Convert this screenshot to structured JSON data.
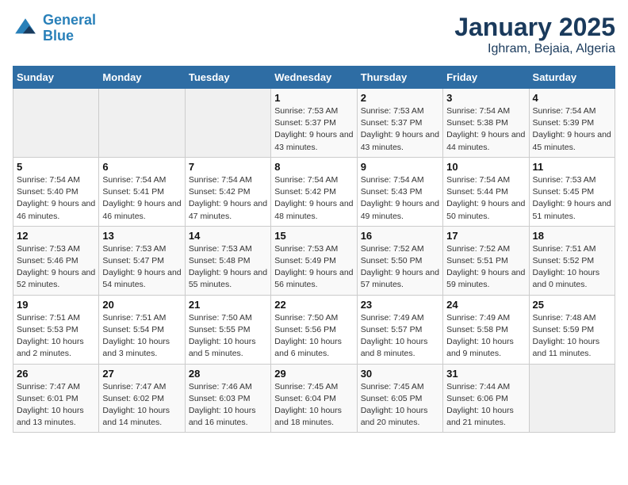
{
  "logo": {
    "line1": "General",
    "line2": "Blue"
  },
  "title": "January 2025",
  "subtitle": "Ighram, Bejaia, Algeria",
  "weekdays": [
    "Sunday",
    "Monday",
    "Tuesday",
    "Wednesday",
    "Thursday",
    "Friday",
    "Saturday"
  ],
  "weeks": [
    [
      {
        "num": "",
        "info": ""
      },
      {
        "num": "",
        "info": ""
      },
      {
        "num": "",
        "info": ""
      },
      {
        "num": "1",
        "info": "Sunrise: 7:53 AM\nSunset: 5:37 PM\nDaylight: 9 hours\nand 43 minutes."
      },
      {
        "num": "2",
        "info": "Sunrise: 7:53 AM\nSunset: 5:37 PM\nDaylight: 9 hours\nand 43 minutes."
      },
      {
        "num": "3",
        "info": "Sunrise: 7:54 AM\nSunset: 5:38 PM\nDaylight: 9 hours\nand 44 minutes."
      },
      {
        "num": "4",
        "info": "Sunrise: 7:54 AM\nSunset: 5:39 PM\nDaylight: 9 hours\nand 45 minutes."
      }
    ],
    [
      {
        "num": "5",
        "info": "Sunrise: 7:54 AM\nSunset: 5:40 PM\nDaylight: 9 hours\nand 46 minutes."
      },
      {
        "num": "6",
        "info": "Sunrise: 7:54 AM\nSunset: 5:41 PM\nDaylight: 9 hours\nand 46 minutes."
      },
      {
        "num": "7",
        "info": "Sunrise: 7:54 AM\nSunset: 5:42 PM\nDaylight: 9 hours\nand 47 minutes."
      },
      {
        "num": "8",
        "info": "Sunrise: 7:54 AM\nSunset: 5:42 PM\nDaylight: 9 hours\nand 48 minutes."
      },
      {
        "num": "9",
        "info": "Sunrise: 7:54 AM\nSunset: 5:43 PM\nDaylight: 9 hours\nand 49 minutes."
      },
      {
        "num": "10",
        "info": "Sunrise: 7:54 AM\nSunset: 5:44 PM\nDaylight: 9 hours\nand 50 minutes."
      },
      {
        "num": "11",
        "info": "Sunrise: 7:53 AM\nSunset: 5:45 PM\nDaylight: 9 hours\nand 51 minutes."
      }
    ],
    [
      {
        "num": "12",
        "info": "Sunrise: 7:53 AM\nSunset: 5:46 PM\nDaylight: 9 hours\nand 52 minutes."
      },
      {
        "num": "13",
        "info": "Sunrise: 7:53 AM\nSunset: 5:47 PM\nDaylight: 9 hours\nand 54 minutes."
      },
      {
        "num": "14",
        "info": "Sunrise: 7:53 AM\nSunset: 5:48 PM\nDaylight: 9 hours\nand 55 minutes."
      },
      {
        "num": "15",
        "info": "Sunrise: 7:53 AM\nSunset: 5:49 PM\nDaylight: 9 hours\nand 56 minutes."
      },
      {
        "num": "16",
        "info": "Sunrise: 7:52 AM\nSunset: 5:50 PM\nDaylight: 9 hours\nand 57 minutes."
      },
      {
        "num": "17",
        "info": "Sunrise: 7:52 AM\nSunset: 5:51 PM\nDaylight: 9 hours\nand 59 minutes."
      },
      {
        "num": "18",
        "info": "Sunrise: 7:51 AM\nSunset: 5:52 PM\nDaylight: 10 hours\nand 0 minutes."
      }
    ],
    [
      {
        "num": "19",
        "info": "Sunrise: 7:51 AM\nSunset: 5:53 PM\nDaylight: 10 hours\nand 2 minutes."
      },
      {
        "num": "20",
        "info": "Sunrise: 7:51 AM\nSunset: 5:54 PM\nDaylight: 10 hours\nand 3 minutes."
      },
      {
        "num": "21",
        "info": "Sunrise: 7:50 AM\nSunset: 5:55 PM\nDaylight: 10 hours\nand 5 minutes."
      },
      {
        "num": "22",
        "info": "Sunrise: 7:50 AM\nSunset: 5:56 PM\nDaylight: 10 hours\nand 6 minutes."
      },
      {
        "num": "23",
        "info": "Sunrise: 7:49 AM\nSunset: 5:57 PM\nDaylight: 10 hours\nand 8 minutes."
      },
      {
        "num": "24",
        "info": "Sunrise: 7:49 AM\nSunset: 5:58 PM\nDaylight: 10 hours\nand 9 minutes."
      },
      {
        "num": "25",
        "info": "Sunrise: 7:48 AM\nSunset: 5:59 PM\nDaylight: 10 hours\nand 11 minutes."
      }
    ],
    [
      {
        "num": "26",
        "info": "Sunrise: 7:47 AM\nSunset: 6:01 PM\nDaylight: 10 hours\nand 13 minutes."
      },
      {
        "num": "27",
        "info": "Sunrise: 7:47 AM\nSunset: 6:02 PM\nDaylight: 10 hours\nand 14 minutes."
      },
      {
        "num": "28",
        "info": "Sunrise: 7:46 AM\nSunset: 6:03 PM\nDaylight: 10 hours\nand 16 minutes."
      },
      {
        "num": "29",
        "info": "Sunrise: 7:45 AM\nSunset: 6:04 PM\nDaylight: 10 hours\nand 18 minutes."
      },
      {
        "num": "30",
        "info": "Sunrise: 7:45 AM\nSunset: 6:05 PM\nDaylight: 10 hours\nand 20 minutes."
      },
      {
        "num": "31",
        "info": "Sunrise: 7:44 AM\nSunset: 6:06 PM\nDaylight: 10 hours\nand 21 minutes."
      },
      {
        "num": "",
        "info": ""
      }
    ]
  ]
}
